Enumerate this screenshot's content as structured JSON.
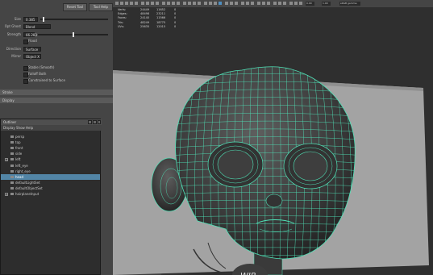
{
  "tool_settings": {
    "buttons": [
      {
        "label": "Reset Tool"
      },
      {
        "label": "Tool Help"
      }
    ],
    "rows": [
      {
        "label": "Size",
        "value": "0.385"
      },
      {
        "label": "Opt Ghost",
        "value": "Blend"
      },
      {
        "label": "Strength",
        "value": "66.283"
      },
      {
        "label": "",
        "value": ""
      },
      {
        "label": "Direction",
        "value": "Surface"
      },
      {
        "label": "Mirror",
        "value": "Object X"
      }
    ],
    "flood_label": "Flood",
    "checkboxes": [
      {
        "label": "Stable (Smooth)"
      },
      {
        "label": "Falloff Both"
      },
      {
        "label": "Constrained to Surface"
      }
    ],
    "sections": [
      {
        "label": "Stroke"
      },
      {
        "label": "Display"
      }
    ]
  },
  "outliner": {
    "title": "Outliner",
    "menu": [
      "Display",
      "Show",
      "Help"
    ],
    "rows": [
      {
        "label": "persp",
        "expanded": false
      },
      {
        "label": "top",
        "expanded": false
      },
      {
        "label": "front",
        "expanded": false
      },
      {
        "label": "side",
        "expanded": false
      },
      {
        "label": "left",
        "expanded": true
      },
      {
        "label": "left_eye",
        "expanded": false
      },
      {
        "label": "right_eye",
        "expanded": false
      },
      {
        "label": "head",
        "expanded": false,
        "selected": true
      },
      {
        "label": "defaultLightSet",
        "expanded": false
      },
      {
        "label": "defaultObjectSet",
        "expanded": false
      },
      {
        "label": "hairplaneInput",
        "expanded": true
      }
    ]
  },
  "viewport_toolbar": {
    "fields": [
      "0.00",
      "1.00"
    ],
    "color_space": "sRGB gamma"
  },
  "hud": {
    "rows": [
      {
        "label": "Verts:",
        "v1": "24449",
        "v2": "11652",
        "v3": "0"
      },
      {
        "label": "Edges:",
        "v1": "48498",
        "v2": "23211",
        "v3": "0"
      },
      {
        "label": "Faces:",
        "v1": "24140",
        "v2": "11566",
        "v3": "0"
      },
      {
        "label": "Tris:",
        "v1": "48249",
        "v2": "18775",
        "v3": "0"
      },
      {
        "label": "UVs:",
        "v1": "25635",
        "v2": "12015",
        "v3": "0"
      }
    ]
  }
}
